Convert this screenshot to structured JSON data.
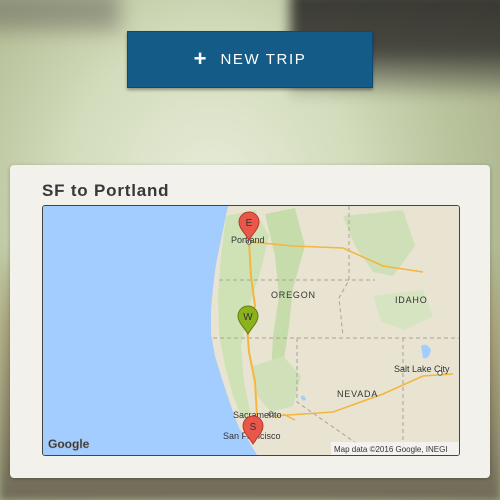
{
  "header": {
    "new_trip": {
      "icon": "plus-icon",
      "label": "NEW TRIP"
    }
  },
  "trip_card": {
    "title": "SF to Portland",
    "map": {
      "labels": {
        "portland": "Portland",
        "oregon": "OREGON",
        "idaho": "IDAHO",
        "nevada": "NEVADA",
        "salt_lake_city": "Salt Lake City",
        "sacramento": "Sacramento",
        "san_francisco": "San Francisco"
      },
      "markers": {
        "end": "E",
        "waypoint": "W",
        "start": "S"
      },
      "logo": "Google",
      "attribution": "Map data ©2016 Google, INEGI"
    }
  },
  "colors": {
    "button_bg": "#155b87",
    "marker_red": "#e8574a",
    "marker_green": "#8bb21e",
    "ocean": "#a3ccff"
  }
}
